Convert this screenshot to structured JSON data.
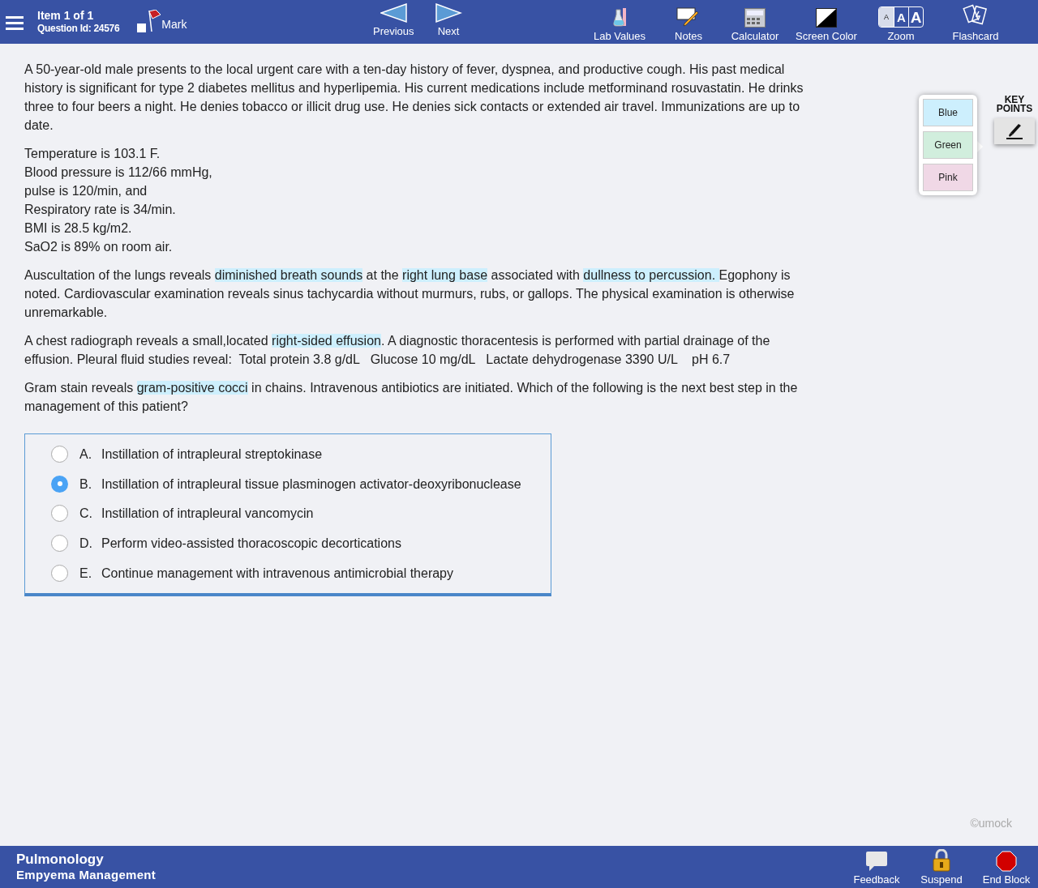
{
  "header": {
    "item": "Item 1 of 1",
    "question_id": "Question Id: 24576",
    "mark": {
      "label": "Mark",
      "checked": false
    },
    "nav": [
      {
        "kind": "previous",
        "label": "Previous"
      },
      {
        "kind": "next",
        "label": "Next"
      }
    ],
    "tools": [
      {
        "kind": "lab",
        "label": "Lab Values"
      },
      {
        "kind": "notes",
        "label": "Notes"
      },
      {
        "kind": "calculator",
        "label": "Calculator"
      },
      {
        "kind": "screen",
        "label": "Screen Color"
      },
      {
        "kind": "zoom",
        "label": "Zoom",
        "letters": [
          "A",
          "A",
          "A"
        ]
      },
      {
        "kind": "flashcard",
        "label": "Flashcard"
      }
    ]
  },
  "question": {
    "paragraphs": [
      [
        {
          "text": "A 50-year-old male presents to the local urgent care with a ten-day history of fever, dyspnea, and productive cough. His past medical history is significant for type 2 diabetes mellitus and hyperlipemia. His current medications include metforminand rosuvastatin. He drinks three to four beers a night. He denies tobacco or illicit drug use. He denies sick contacts or extended air travel. Immunizations are up to date.",
          "highlight": false
        }
      ],
      [
        {
          "text": "Temperature is 103.1 F.\nBlood pressure is 112/66 mmHg,\npulse is 120/min, and\nRespiratory rate is 34/min.\nBMI is 28.5 kg/m2.\nSaO2 is 89% on room air.",
          "highlight": false
        }
      ],
      [
        {
          "text": "Auscultation of the lungs reveals ",
          "highlight": false
        },
        {
          "text": "diminished breath sounds",
          "highlight": true
        },
        {
          "text": " at the ",
          "highlight": false
        },
        {
          "text": "right lung base",
          "highlight": true
        },
        {
          "text": " associated with ",
          "highlight": false
        },
        {
          "text": "dullness to percussion. ",
          "highlight": true
        },
        {
          "text": "Egophony is noted. Cardiovascular examination reveals sinus tachycardia without murmurs, rubs, or gallops. The physical examination is otherwise unremarkable.",
          "highlight": false
        }
      ],
      [
        {
          "text": "A chest radiograph reveals a small,located ",
          "highlight": false
        },
        {
          "text": "right-sided effusion",
          "highlight": true
        },
        {
          "text": ". A diagnostic thoracentesis is performed with partial drainage of the effusion. Pleural fluid studies reveal:  Total protein 3.8 g/dL   Glucose 10 mg/dL   Lactate dehydrogenase 3390 U/L    pH 6.7",
          "highlight": false
        }
      ],
      [
        {
          "text": "Gram stain reveals ",
          "highlight": false
        },
        {
          "text": "gram-positive cocci",
          "highlight": true
        },
        {
          "text": " in chains. Intravenous antibiotics are initiated. Which of the following is the next best step in the management of this patient?",
          "highlight": false
        }
      ]
    ],
    "choices": [
      {
        "letter": "A.",
        "text": "Instillation of intrapleural streptokinase",
        "selected": false
      },
      {
        "letter": "B.",
        "text": "Instillation of intrapleural tissue plasminogen activator-deoxyribonuclease",
        "selected": true
      },
      {
        "letter": "C.",
        "text": "Instillation of intrapleural vancomycin",
        "selected": false
      },
      {
        "letter": "D.",
        "text": "Perform video-assisted thoracoscopic decortications",
        "selected": false
      },
      {
        "letter": "E.",
        "text": "Continue management with intravenous antimicrobial therapy",
        "selected": false
      }
    ]
  },
  "highlighter": {
    "colors": [
      {
        "label": "Blue",
        "color": "#cdeffd"
      },
      {
        "label": "Green",
        "color": "#d1eedd"
      },
      {
        "label": "Pink",
        "color": "#f0d8e6"
      }
    ],
    "title": "KEY POINTS"
  },
  "copyright": "©umock",
  "footer": {
    "subject": "Pulmonology",
    "topic": "Empyema Management",
    "actions": [
      {
        "kind": "feedback",
        "label": "Feedback"
      },
      {
        "kind": "suspend",
        "label": "Suspend"
      },
      {
        "kind": "end",
        "label": "End Block"
      }
    ]
  }
}
